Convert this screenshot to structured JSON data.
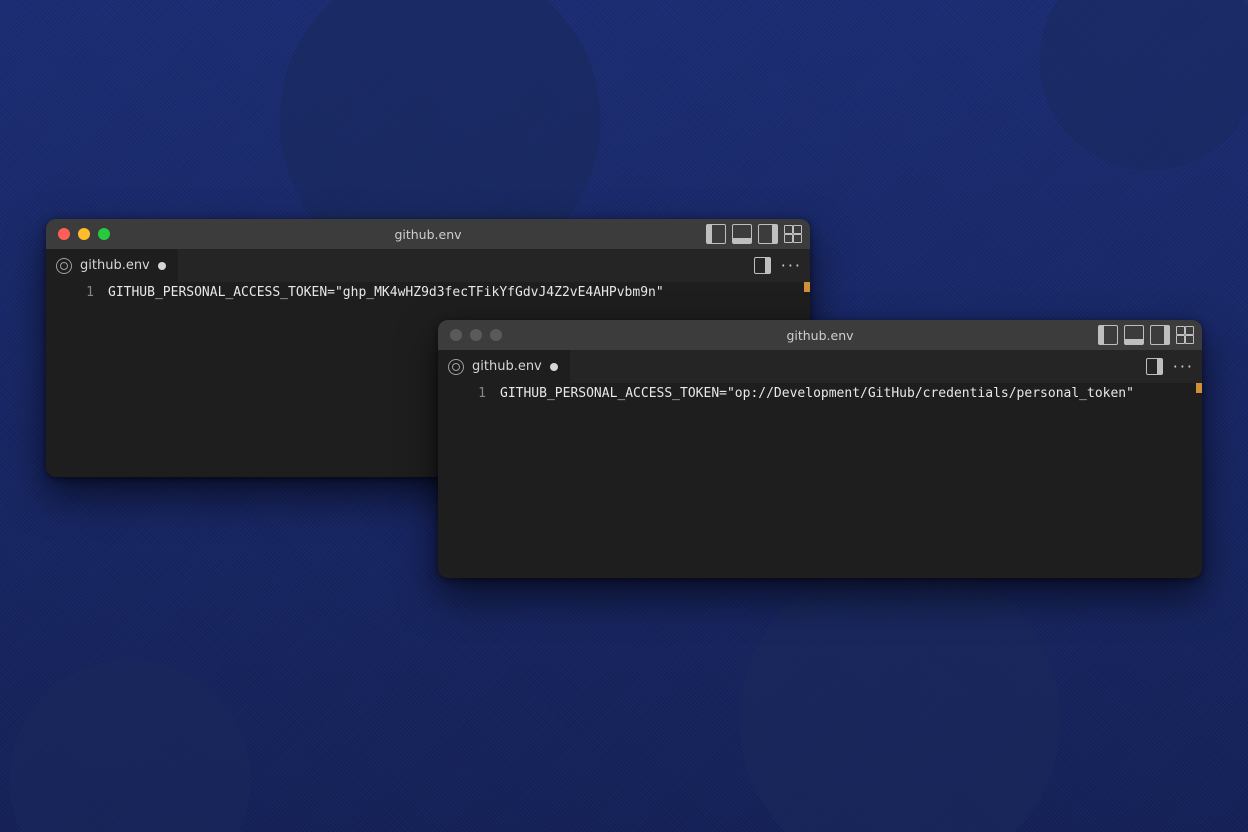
{
  "windows": [
    {
      "title": "github.env",
      "active": true,
      "tab": {
        "label": "github.env",
        "modified": true
      },
      "line_number": "1",
      "code": "GITHUB_PERSONAL_ACCESS_TOKEN=\"ghp_MK4wHZ9d3fecTFikYfGdvJ4Z2vE4AHPvbm9n\""
    },
    {
      "title": "github.env",
      "active": false,
      "tab": {
        "label": "github.env",
        "modified": true
      },
      "line_number": "1",
      "code": "GITHUB_PERSONAL_ACCESS_TOKEN=\"op://Development/GitHub/credentials/personal_token\""
    }
  ]
}
